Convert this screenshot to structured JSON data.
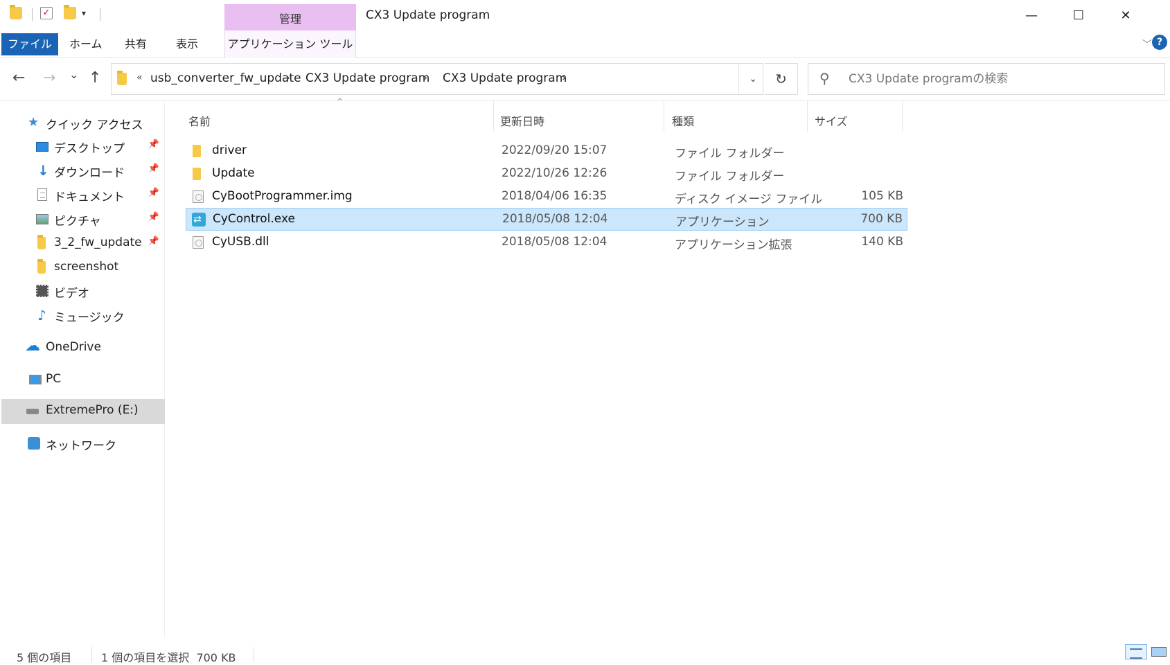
{
  "window": {
    "title": "CX3 Update program",
    "manage_label": "管理",
    "minimize": "—",
    "maximize": "☐",
    "close": "✕"
  },
  "ribbon": {
    "tabs": {
      "file": "ファイル",
      "home": "ホーム",
      "share": "共有",
      "view": "表示",
      "app_tools": "アプリケーション ツール"
    },
    "help": "?"
  },
  "nav": {
    "back": "←",
    "forward": "→",
    "recent": "⌄",
    "up": "↑",
    "overflow": "«",
    "breadcrumbs": [
      "usb_converter_fw_update",
      "CX3 Update program",
      "CX3 Update program"
    ],
    "separator": "›",
    "refresh": "↻"
  },
  "search": {
    "placeholder": "CX3 Update programの検索"
  },
  "sidebar": {
    "items": [
      {
        "label": "クイック アクセス"
      },
      {
        "label": "デスクトップ"
      },
      {
        "label": "ダウンロード"
      },
      {
        "label": "ドキュメント"
      },
      {
        "label": "ピクチャ"
      },
      {
        "label": "3_2_fw_update"
      },
      {
        "label": "screenshot"
      },
      {
        "label": "ビデオ"
      },
      {
        "label": "ミュージック"
      },
      {
        "label": "OneDrive"
      },
      {
        "label": "PC"
      },
      {
        "label": "ExtremePro (E:)"
      },
      {
        "label": "ネットワーク"
      }
    ]
  },
  "columns": {
    "name": "名前",
    "date": "更新日時",
    "type": "種類",
    "size": "サイズ"
  },
  "files": [
    {
      "name": "driver",
      "date": "2022/09/20 15:07",
      "type": "ファイル フォルダー",
      "size": "",
      "icon": "folder-icon"
    },
    {
      "name": "Update",
      "date": "2022/10/26 12:26",
      "type": "ファイル フォルダー",
      "size": "",
      "icon": "folder-icon"
    },
    {
      "name": "CyBootProgrammer.img",
      "date": "2018/04/06 16:35",
      "type": "ディスク イメージ ファイル",
      "size": "105 KB",
      "icon": "disk-image-icon"
    },
    {
      "name": "CyControl.exe",
      "date": "2018/05/08 12:04",
      "type": "アプリケーション",
      "size": "700 KB",
      "icon": "application-icon",
      "selected": true
    },
    {
      "name": "CyUSB.dll",
      "date": "2018/05/08 12:04",
      "type": "アプリケーション拡張",
      "size": "140 KB",
      "icon": "dll-icon"
    }
  ],
  "status": {
    "count": "5 個の項目",
    "selection": "1 個の項目を選択  700 KB"
  }
}
